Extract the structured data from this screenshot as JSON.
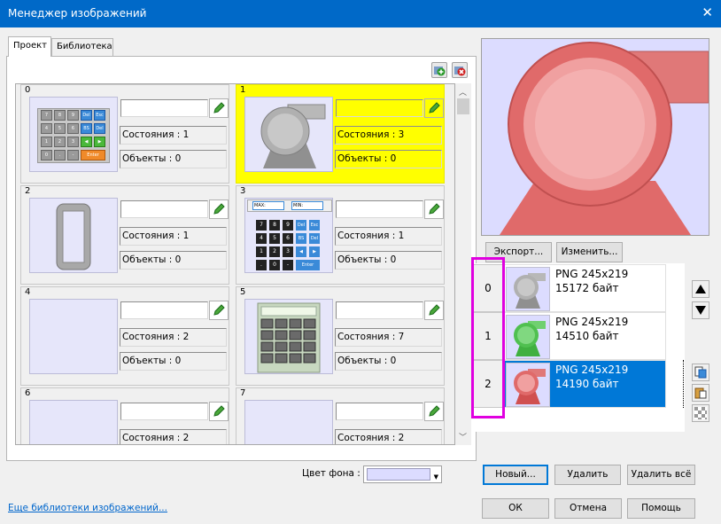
{
  "window": {
    "title": "Менеджер изображений",
    "close_glyph": "✕"
  },
  "tabs": [
    {
      "label": "Проект"
    },
    {
      "label": "Библиотека"
    }
  ],
  "cards": [
    {
      "num": "0",
      "states": "Состояния : 1",
      "objects": "Объекты : 0",
      "thumb": "keypad"
    },
    {
      "num": "1",
      "states": "Состояния : 3",
      "objects": "Объекты : 0",
      "thumb": "pump-gray"
    },
    {
      "num": "2",
      "states": "Состояния : 1",
      "objects": "Объекты : 0",
      "thumb": "tank"
    },
    {
      "num": "3",
      "states": "Состояния : 1",
      "objects": "Объекты : 0",
      "thumb": "numpad"
    },
    {
      "num": "4",
      "states": "Состояния : 2",
      "objects": "Объекты : 0",
      "thumb": "empty"
    },
    {
      "num": "5",
      "states": "Состояния : 7",
      "objects": "Объекты : 0",
      "thumb": "panel"
    },
    {
      "num": "6",
      "states": "Состояния : 2",
      "objects": "",
      "thumb": "empty"
    },
    {
      "num": "7",
      "states": "Состояния : 2",
      "objects": "",
      "thumb": "empty"
    }
  ],
  "keypad_keys": [
    "7",
    "8",
    "9",
    "Del",
    "Esc",
    "4",
    "5",
    "6",
    "BS",
    "Del",
    "1",
    "2",
    "3",
    "◀",
    "▶",
    "0",
    ".",
    "-",
    "Enter"
  ],
  "numpad_keys": [
    "7",
    "8",
    "9",
    "Del",
    "Esc",
    "4",
    "5",
    "6",
    "BS",
    "Del",
    "1",
    "2",
    "3",
    "◀",
    "▶",
    ".",
    "0",
    "-",
    "Enter"
  ],
  "numpad_displays": [
    "MAX:",
    "MIN:"
  ],
  "preview": {
    "export_label": "Экспорт...",
    "edit_label": "Изменить..."
  },
  "images": [
    {
      "index": "0",
      "format": "PNG 245x219",
      "size": "15172 байт",
      "color": "gray"
    },
    {
      "index": "1",
      "format": "PNG 245x219",
      "size": "14510 байт",
      "color": "green"
    },
    {
      "index": "2",
      "format": "PNG 245x219",
      "size": "14190 байт",
      "color": "red"
    }
  ],
  "bg_label": "Цвет фона :",
  "buttons": {
    "new": "Новый...",
    "delete": "Удалить",
    "delete_all": "Удалить всё",
    "ok": "ОК",
    "cancel": "Отмена",
    "help": "Помощь"
  },
  "link": "Еще библиотеки изображений...",
  "colors": {
    "titlebar": "#0069c8",
    "selection": "#0078d7",
    "highlight": "#ffff00",
    "thumb_bg": "#dcdcff",
    "annotation": "#e000e0"
  }
}
